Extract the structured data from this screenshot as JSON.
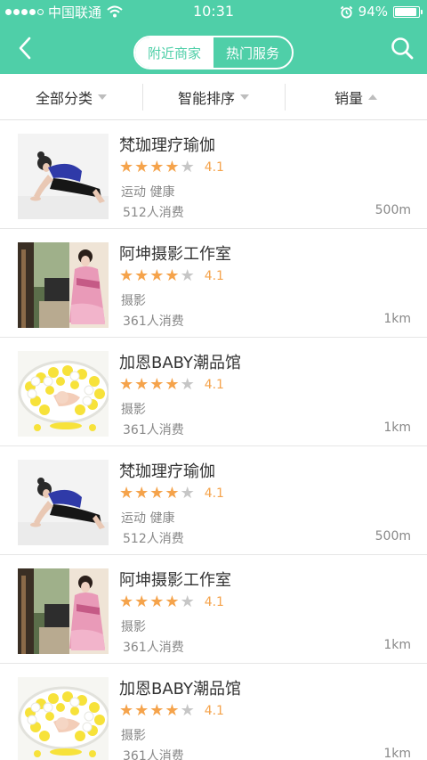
{
  "status_bar": {
    "carrier": "中国联通",
    "time": "10:31",
    "battery": "94%",
    "battery_level": 0.94
  },
  "header": {
    "tabs": [
      {
        "label": "附近商家",
        "active": true
      },
      {
        "label": "热门服务",
        "active": false
      }
    ],
    "back_icon": "chevron-left-icon",
    "search_icon": "search-icon"
  },
  "filters": [
    {
      "label": "全部分类",
      "arrow": "down"
    },
    {
      "label": "智能排序",
      "arrow": "down"
    },
    {
      "label": "销量",
      "arrow": "up"
    }
  ],
  "colors": {
    "brand": "#4fcfa8",
    "star": "#f5a34b",
    "star_off": "#c6c6c6"
  },
  "merchants": [
    {
      "name": "梵珈理疗瑜伽",
      "stars": 4,
      "score": "4.1",
      "category": "运动 健康",
      "consumers": "512人消费",
      "distance": "500m",
      "image": "yoga"
    },
    {
      "name": "阿坤摄影工作室",
      "stars": 4,
      "score": "4.1",
      "category": "摄影",
      "consumers": "361人消费",
      "distance": "1km",
      "image": "kimono"
    },
    {
      "name": "加恩BABY潮品馆",
      "stars": 4,
      "score": "4.1",
      "category": "摄影",
      "consumers": "361人消费",
      "distance": "1km",
      "image": "baby"
    },
    {
      "name": "梵珈理疗瑜伽",
      "stars": 4,
      "score": "4.1",
      "category": "运动 健康",
      "consumers": "512人消费",
      "distance": "500m",
      "image": "yoga"
    },
    {
      "name": "阿坤摄影工作室",
      "stars": 4,
      "score": "4.1",
      "category": "摄影",
      "consumers": "361人消费",
      "distance": "1km",
      "image": "kimono"
    },
    {
      "name": "加恩BABY潮品馆",
      "stars": 4,
      "score": "4.1",
      "category": "摄影",
      "consumers": "361人消费",
      "distance": "1km",
      "image": "baby"
    }
  ]
}
